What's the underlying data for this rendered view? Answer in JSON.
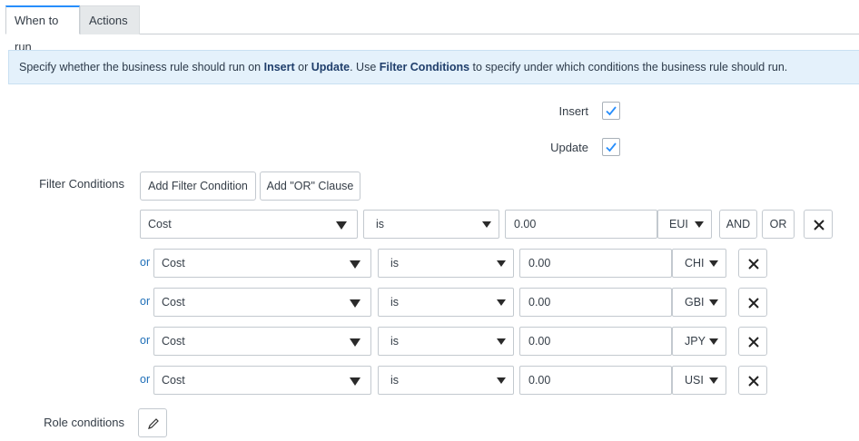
{
  "tabs": [
    {
      "label": "When to run",
      "active": true
    },
    {
      "label": "Actions",
      "active": false
    }
  ],
  "info": {
    "part1": "Specify whether the business rule should run on ",
    "insert": "Insert",
    "part2": " or ",
    "update": "Update",
    "part3": ". Use ",
    "filter": "Filter Conditions",
    "part4": " to specify under which conditions the business rule should run."
  },
  "checkboxes": {
    "insert": {
      "label": "Insert",
      "checked": true
    },
    "update": {
      "label": "Update",
      "checked": true
    }
  },
  "filter": {
    "label": "Filter Conditions",
    "add_condition": "Add Filter Condition",
    "add_or": "Add \"OR\" Clause",
    "and_label": "AND",
    "or_label": "OR",
    "or_prefix": "or",
    "rows": [
      {
        "field": "Cost",
        "operator": "is",
        "value": "0.00",
        "currency": "EUI"
      },
      {
        "field": "Cost",
        "operator": "is",
        "value": "0.00",
        "currency": "CHI"
      },
      {
        "field": "Cost",
        "operator": "is",
        "value": "0.00",
        "currency": "GBI"
      },
      {
        "field": "Cost",
        "operator": "is",
        "value": "0.00",
        "currency": "JPY"
      },
      {
        "field": "Cost",
        "operator": "is",
        "value": "0.00",
        "currency": "USI"
      }
    ]
  },
  "role": {
    "label": "Role conditions"
  },
  "colors": {
    "accent": "#278efc",
    "info_bg": "#e4f1fb",
    "or_link": "#1f6fb8"
  }
}
